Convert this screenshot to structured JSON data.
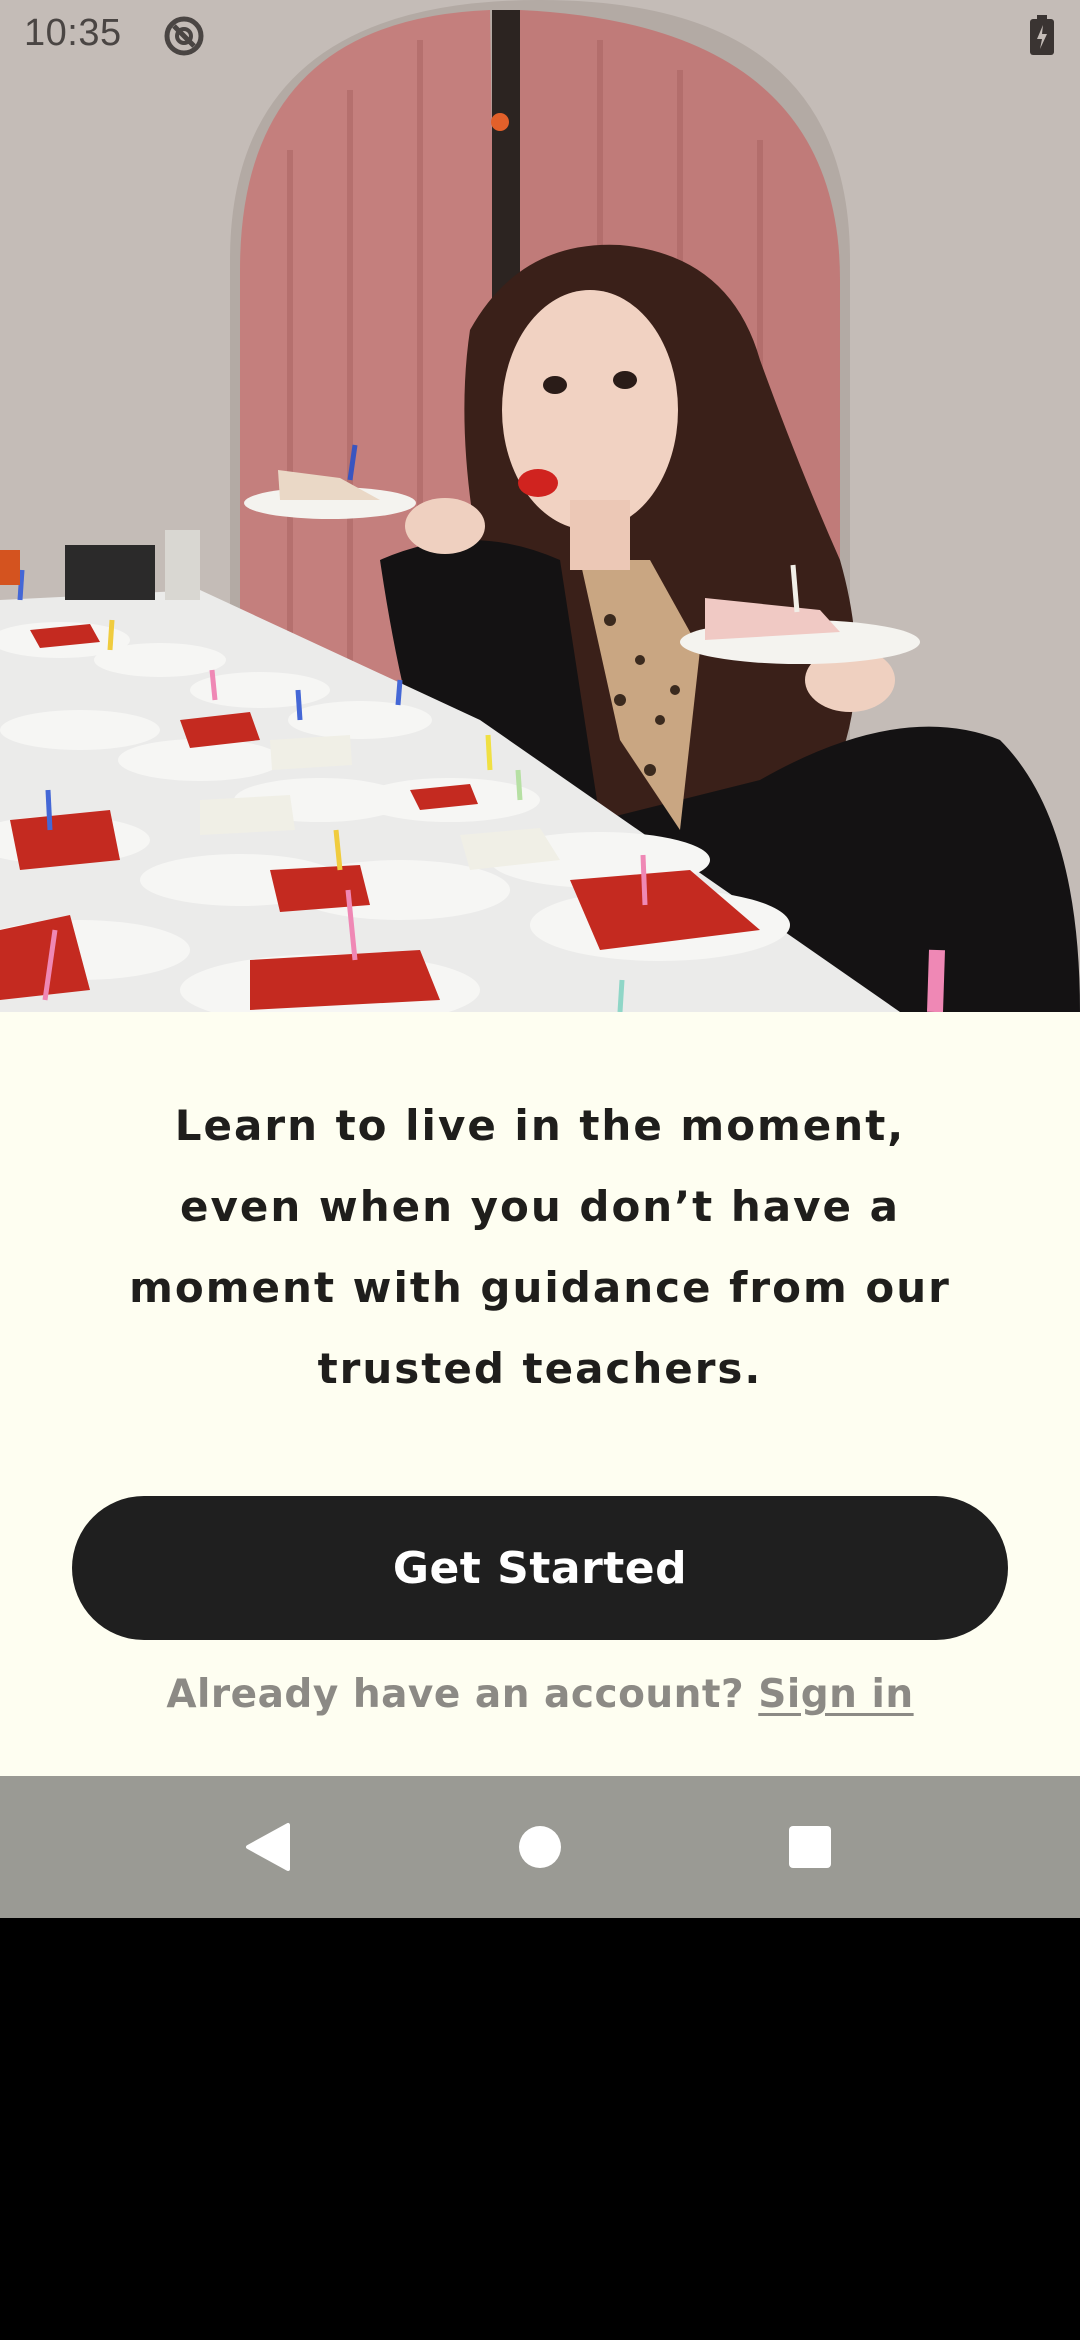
{
  "status_bar": {
    "time": "10:35",
    "dnd_icon": "do-not-disturb-icon",
    "battery_icon": "battery-icon"
  },
  "hero": {
    "image_icon": "hero-photo"
  },
  "onboarding": {
    "headline": "Learn to live in the moment,\neven when you don’t have a\nmoment with guidance from our\ntrusted teachers.",
    "cta_label": "Get Started",
    "account_prompt": "Already have an account?",
    "signin_label": "Sign in"
  },
  "nav_bar": {
    "back_icon": "back-triangle-icon",
    "home_icon": "home-circle-icon",
    "recents_icon": "recents-square-icon"
  },
  "colors": {
    "background": "#fefef1",
    "button": "#1f1f1f",
    "button_text": "#ffffff",
    "headline": "#1f1e1c",
    "secondary_text": "#8c8a85",
    "nav_bar": "#9a9a94"
  }
}
